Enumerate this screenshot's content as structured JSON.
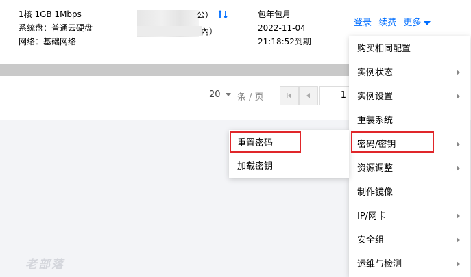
{
  "instance": {
    "spec": "1核 1GB 1Mbps",
    "system_disk": "系统盘：普通云硬盘",
    "network": "网络：基础网络",
    "name_tail_1": "公）",
    "name_tail_2": "內）",
    "billing_type": "包年包月",
    "expire_date": "2022-11-04",
    "expire_time": "21:18:52到期"
  },
  "actions": {
    "login": "登录",
    "renew": "续费",
    "more": "更多"
  },
  "pagination": {
    "page_size": "20",
    "per_page_label": "条 / 页",
    "page_number": "1"
  },
  "more_menu": {
    "items": [
      {
        "label": "购买相同配置",
        "has_submenu": false
      },
      {
        "label": "实例状态",
        "has_submenu": true
      },
      {
        "label": "实例设置",
        "has_submenu": true
      },
      {
        "label": "重装系统",
        "has_submenu": false
      },
      {
        "label": "密码/密钥",
        "has_submenu": true
      },
      {
        "label": "资源调整",
        "has_submenu": true
      },
      {
        "label": "制作镜像",
        "has_submenu": false
      },
      {
        "label": "IP/网卡",
        "has_submenu": true
      },
      {
        "label": "安全组",
        "has_submenu": true
      },
      {
        "label": "运维与检测",
        "has_submenu": true
      }
    ]
  },
  "password_submenu": {
    "items": [
      {
        "label": "重置密码"
      },
      {
        "label": "加载密钥"
      }
    ]
  },
  "highlight_color": "#e0262a",
  "accent_color": "#006eff",
  "watermark": "老部落"
}
